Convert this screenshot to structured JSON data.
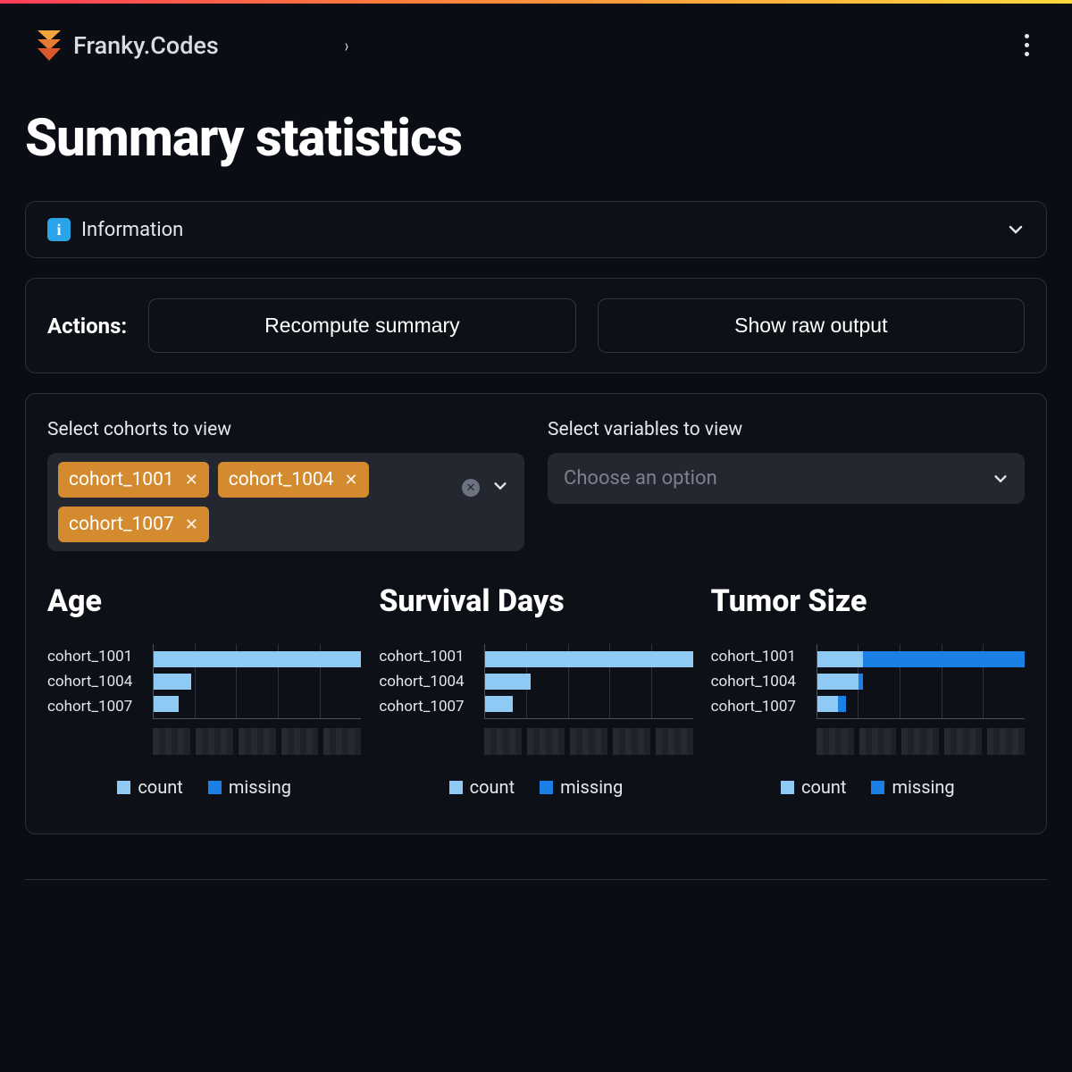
{
  "header": {
    "brand": "Franky.Codes",
    "breadcrumb_separator": "›"
  },
  "page": {
    "title": "Summary statistics"
  },
  "info_panel": {
    "label": "Information",
    "icon_text": "i"
  },
  "actions": {
    "label": "Actions:",
    "recompute": "Recompute summary",
    "show_raw": "Show raw output"
  },
  "filters": {
    "cohorts_label": "Select cohorts to view",
    "variables_label": "Select variables to view",
    "variables_placeholder": "Choose an option",
    "selected_cohorts": [
      "cohort_1001",
      "cohort_1004",
      "cohort_1007"
    ]
  },
  "legend": {
    "count": "count",
    "missing": "missing"
  },
  "chart_data": [
    {
      "title": "Age",
      "type": "bar",
      "categories": [
        "cohort_1001",
        "cohort_1004",
        "cohort_1007"
      ],
      "xmax": 100,
      "series": [
        {
          "name": "count",
          "values": [
            100,
            18,
            12
          ]
        },
        {
          "name": "missing",
          "values": [
            0,
            0,
            0
          ]
        }
      ]
    },
    {
      "title": "Survival Days",
      "type": "bar",
      "categories": [
        "cohort_1001",
        "cohort_1004",
        "cohort_1007"
      ],
      "xmax": 100,
      "series": [
        {
          "name": "count",
          "values": [
            100,
            22,
            13
          ]
        },
        {
          "name": "missing",
          "values": [
            0,
            0,
            0
          ]
        }
      ]
    },
    {
      "title": "Tumor Size",
      "type": "bar",
      "categories": [
        "cohort_1001",
        "cohort_1004",
        "cohort_1007"
      ],
      "xmax": 100,
      "series": [
        {
          "name": "count",
          "values": [
            22,
            20,
            10
          ]
        },
        {
          "name": "missing",
          "values": [
            78,
            2,
            4
          ]
        }
      ]
    }
  ]
}
